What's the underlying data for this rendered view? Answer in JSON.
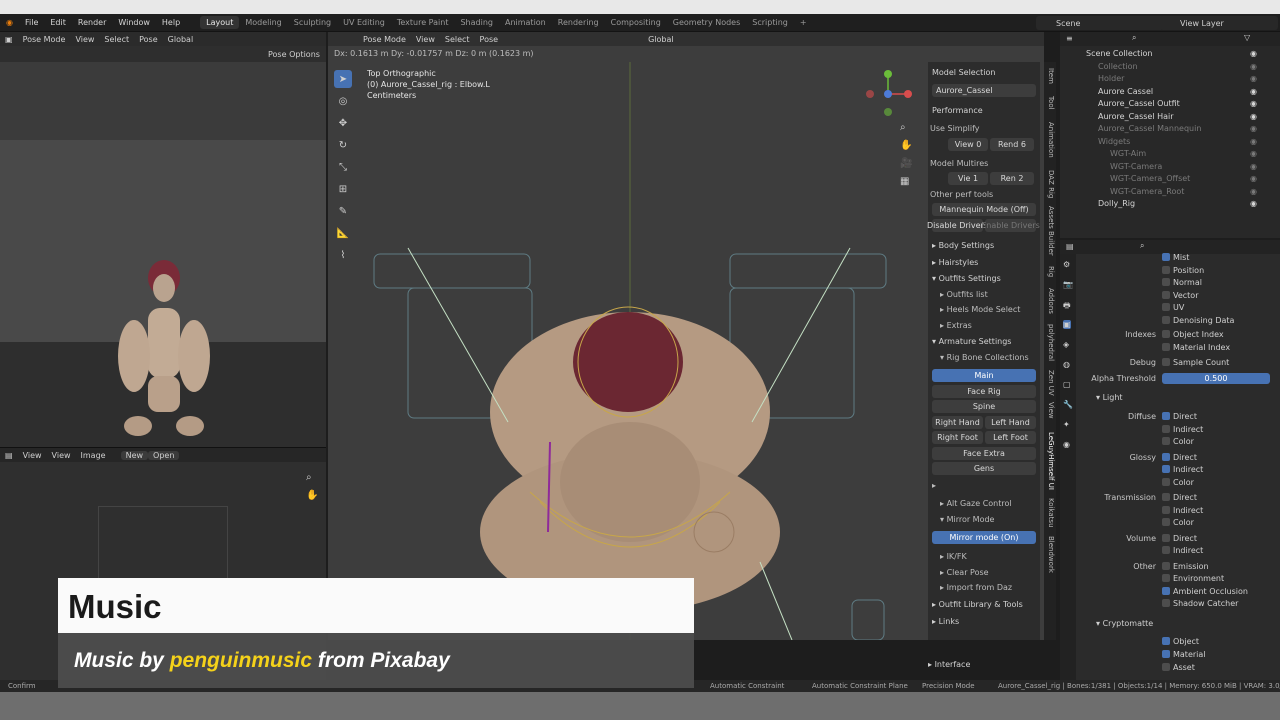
{
  "menubar": {
    "menus": [
      "File",
      "Edit",
      "Render",
      "Window",
      "Help"
    ],
    "workspaces": [
      "Layout",
      "Modeling",
      "Sculpting",
      "UV Editing",
      "Texture Paint",
      "Shading",
      "Animation",
      "Rendering",
      "Compositing",
      "Geometry Nodes",
      "Scripting"
    ],
    "active_workspace": "Layout",
    "scene": "Scene",
    "view_layer": "View Layer"
  },
  "left_panel": {
    "mode": "Pose Mode",
    "items": [
      "View",
      "Select",
      "Pose"
    ],
    "orientation": "Global",
    "pose_options": "Pose Options"
  },
  "image_editor": {
    "items": [
      "View",
      "View",
      "Image"
    ],
    "new_label": "New",
    "open_label": "Open"
  },
  "viewport": {
    "mode": "Pose Mode",
    "items": [
      "View",
      "Select",
      "Pose"
    ],
    "orientation": "Global",
    "transform_readout": "Dx: 0.1613 m   Dy: -0.01757 m   Dz: 0 m (0.1623 m)",
    "view_name": "Top Orthographic",
    "active_object": "(0) Aurore_Cassel_rig : Elbow.L",
    "units": "Centimeters"
  },
  "npanel": {
    "model_selection": "Model Selection",
    "model_name": "Aurore_Cassel",
    "performance": "Performance",
    "use_simplify": "Use Simplify",
    "view_label": "View",
    "view_value": "0",
    "rend_label": "Rend",
    "rend_value": "6",
    "model_multires": "Model Multires",
    "vie_label": "Vie",
    "vie_value": "1",
    "ren_label": "Ren",
    "ren_value": "2",
    "other_perf": "Other perf tools",
    "mannequin": "Mannequin Mode (Off)",
    "disable_drivers": "Disable Drivers",
    "enable_drivers": "Enable Drivers",
    "body_settings": "Body Settings",
    "hairstyles": "Hairstyles",
    "outfits_settings": "Outfits Settings",
    "outfits_list": "Outfits list",
    "heels_mode": "Heels Mode Select",
    "extras": "Extras",
    "armature_settings": "Armature Settings",
    "rig_bone_collections": "Rig Bone Collections",
    "main": "Main",
    "face_rig": "Face Rig",
    "spine": "Spine",
    "right_hand": "Right Hand",
    "left_hand": "Left Hand",
    "right_foot": "Right Foot",
    "left_foot": "Left Foot",
    "face_extra": "Face Extra",
    "gens": "Gens",
    "alt_gaze": "Alt Gaze Control",
    "mirror_mode": "Mirror Mode",
    "mirror_mode_on": "Mirror mode (On)",
    "ikfk": "IK/FK",
    "clear_pose": "Clear Pose",
    "import_daz": "Import from Daz",
    "outfit_library": "Outfit Library & Tools",
    "links": "Links",
    "interface": "Interface",
    "tabs": [
      "Item",
      "Tool",
      "Animation",
      "DAZ Rig",
      "Assets Builder",
      "Rig",
      "Addons",
      "polyhedral",
      "Zen UV",
      "View",
      "LeGuyHimself UI",
      "Koikatsu",
      "Blendwork"
    ]
  },
  "outliner": {
    "rows": [
      {
        "label": "Scene Collection",
        "dim": false,
        "indent": 0
      },
      {
        "label": "Collection",
        "dim": true,
        "indent": 1
      },
      {
        "label": "Holder",
        "dim": true,
        "indent": 1
      },
      {
        "label": "Aurore Cassel",
        "dim": false,
        "indent": 1
      },
      {
        "label": "Aurore_Cassel Outfit",
        "dim": false,
        "indent": 1
      },
      {
        "label": "Aurore_Cassel Hair",
        "dim": false,
        "indent": 1
      },
      {
        "label": "Aurore_Cassel Mannequin",
        "dim": true,
        "indent": 1
      },
      {
        "label": "Widgets",
        "dim": true,
        "indent": 1
      },
      {
        "label": "WGT-Aim",
        "dim": true,
        "indent": 2
      },
      {
        "label": "WGT-Camera",
        "dim": true,
        "indent": 2
      },
      {
        "label": "WGT-Camera_Offset",
        "dim": true,
        "indent": 2
      },
      {
        "label": "WGT-Camera_Root",
        "dim": true,
        "indent": 2
      },
      {
        "label": "Dolly_Rig",
        "dim": false,
        "indent": 1
      }
    ]
  },
  "properties": {
    "passes": [
      "Mist",
      "Position",
      "Normal",
      "Vector",
      "UV",
      "Denoising Data"
    ],
    "passes_on": [
      true,
      false,
      false,
      false,
      false,
      false
    ],
    "indexes_label": "Indexes",
    "indexes": [
      "Object Index",
      "Material Index"
    ],
    "debug_label": "Debug",
    "debug": "Sample Count",
    "alpha_label": "Alpha Threshold",
    "alpha_value": "0.500",
    "light_section": "Light",
    "diffuse_label": "Diffuse",
    "glossy_label": "Glossy",
    "transmission_label": "Transmission",
    "volume_label": "Volume",
    "other_label": "Other",
    "direct": "Direct",
    "indirect": "Indirect",
    "color": "Color",
    "emission": "Emission",
    "environment": "Environment",
    "ambient_occlusion": "Ambient Occlusion",
    "shadow_catcher": "Shadow Catcher",
    "cryptomatte_section": "Cryptomatte",
    "object": "Object",
    "material": "Material",
    "asset": "Asset"
  },
  "statusbar": {
    "left": "Confirm",
    "auto_constraint": "Automatic Constraint",
    "auto_constraint_plane": "Automatic Constraint Plane",
    "precision": "Precision Mode",
    "stats": "Aurore_Cassel_rig | Bones:1/381 | Objects:1/14 | Memory: 650.0 MiB | VRAM: 3.0/16"
  },
  "overlay": {
    "title": "Music",
    "prefix": "Music by ",
    "artist": "penguinmusic",
    "suffix": " from Pixabay"
  },
  "colors": {
    "accent": "#4772b3",
    "highlight": "#f5d21a"
  }
}
